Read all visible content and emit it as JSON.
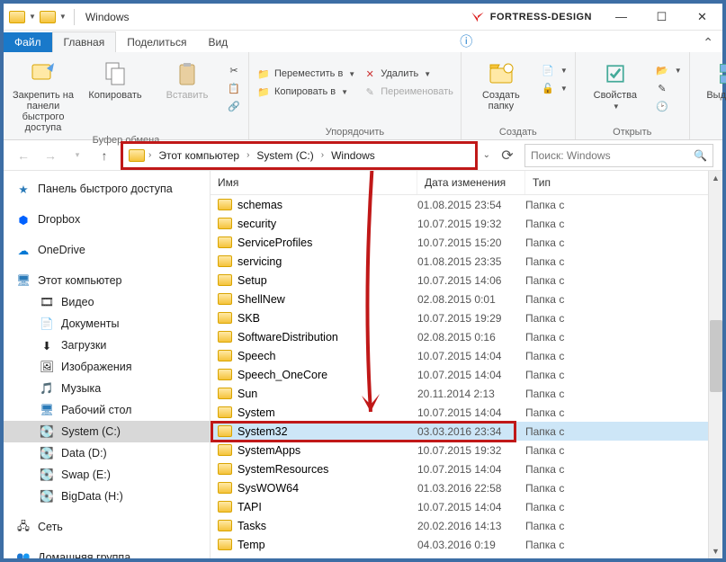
{
  "title": "Windows",
  "brand": "FORTRESS-DESIGN",
  "menu": {
    "file": "Файл",
    "home": "Главная",
    "share": "Поделиться",
    "view": "Вид"
  },
  "ribbon": {
    "clipboard": {
      "pin": "Закрепить на панели быстрого доступа",
      "copy": "Копировать",
      "paste": "Вставить",
      "label": "Буфер обмена"
    },
    "organize": {
      "move": "Переместить в",
      "copy_to": "Копировать в",
      "delete": "Удалить",
      "rename": "Переименовать",
      "label": "Упорядочить"
    },
    "new": {
      "new_folder": "Создать папку",
      "label": "Создать"
    },
    "open": {
      "properties": "Свойства",
      "label": "Открыть"
    },
    "select": {
      "select_all": "Выделить",
      "label": ""
    }
  },
  "breadcrumb": {
    "pc": "Этот компьютер",
    "drive": "System (C:)",
    "folder": "Windows"
  },
  "search": {
    "placeholder": "Поиск: Windows"
  },
  "columns": {
    "name": "Имя",
    "date": "Дата изменения",
    "type": "Тип"
  },
  "type_folder": "Папка с",
  "sidebar": {
    "quick": "Панель быстрого доступа",
    "dropbox": "Dropbox",
    "onedrive": "OneDrive",
    "this_pc": "Этот компьютер",
    "videos": "Видео",
    "documents": "Документы",
    "downloads": "Загрузки",
    "pictures": "Изображения",
    "music": "Музыка",
    "desktop": "Рабочий стол",
    "system_c": "System (C:)",
    "data_d": "Data (D:)",
    "swap_e": "Swap (E:)",
    "bigdata_h": "BigData (H:)",
    "network": "Сеть",
    "homegroup": "Домашняя группа"
  },
  "files": [
    {
      "name": "schemas",
      "date": "01.08.2015 23:54"
    },
    {
      "name": "security",
      "date": "10.07.2015 19:32"
    },
    {
      "name": "ServiceProfiles",
      "date": "10.07.2015 15:20"
    },
    {
      "name": "servicing",
      "date": "01.08.2015 23:35"
    },
    {
      "name": "Setup",
      "date": "10.07.2015 14:06"
    },
    {
      "name": "ShellNew",
      "date": "02.08.2015 0:01"
    },
    {
      "name": "SKB",
      "date": "10.07.2015 19:29"
    },
    {
      "name": "SoftwareDistribution",
      "date": "02.08.2015 0:16"
    },
    {
      "name": "Speech",
      "date": "10.07.2015 14:04"
    },
    {
      "name": "Speech_OneCore",
      "date": "10.07.2015 14:04"
    },
    {
      "name": "Sun",
      "date": "20.11.2014 2:13"
    },
    {
      "name": "System",
      "date": "10.07.2015 14:04"
    },
    {
      "name": "System32",
      "date": "03.03.2016 23:34",
      "selected": true
    },
    {
      "name": "SystemApps",
      "date": "10.07.2015 19:32"
    },
    {
      "name": "SystemResources",
      "date": "10.07.2015 14:04"
    },
    {
      "name": "SysWOW64",
      "date": "01.03.2016 22:58"
    },
    {
      "name": "TAPI",
      "date": "10.07.2015 14:04"
    },
    {
      "name": "Tasks",
      "date": "20.02.2016 14:13"
    },
    {
      "name": "Temp",
      "date": "04.03.2016 0:19"
    }
  ]
}
